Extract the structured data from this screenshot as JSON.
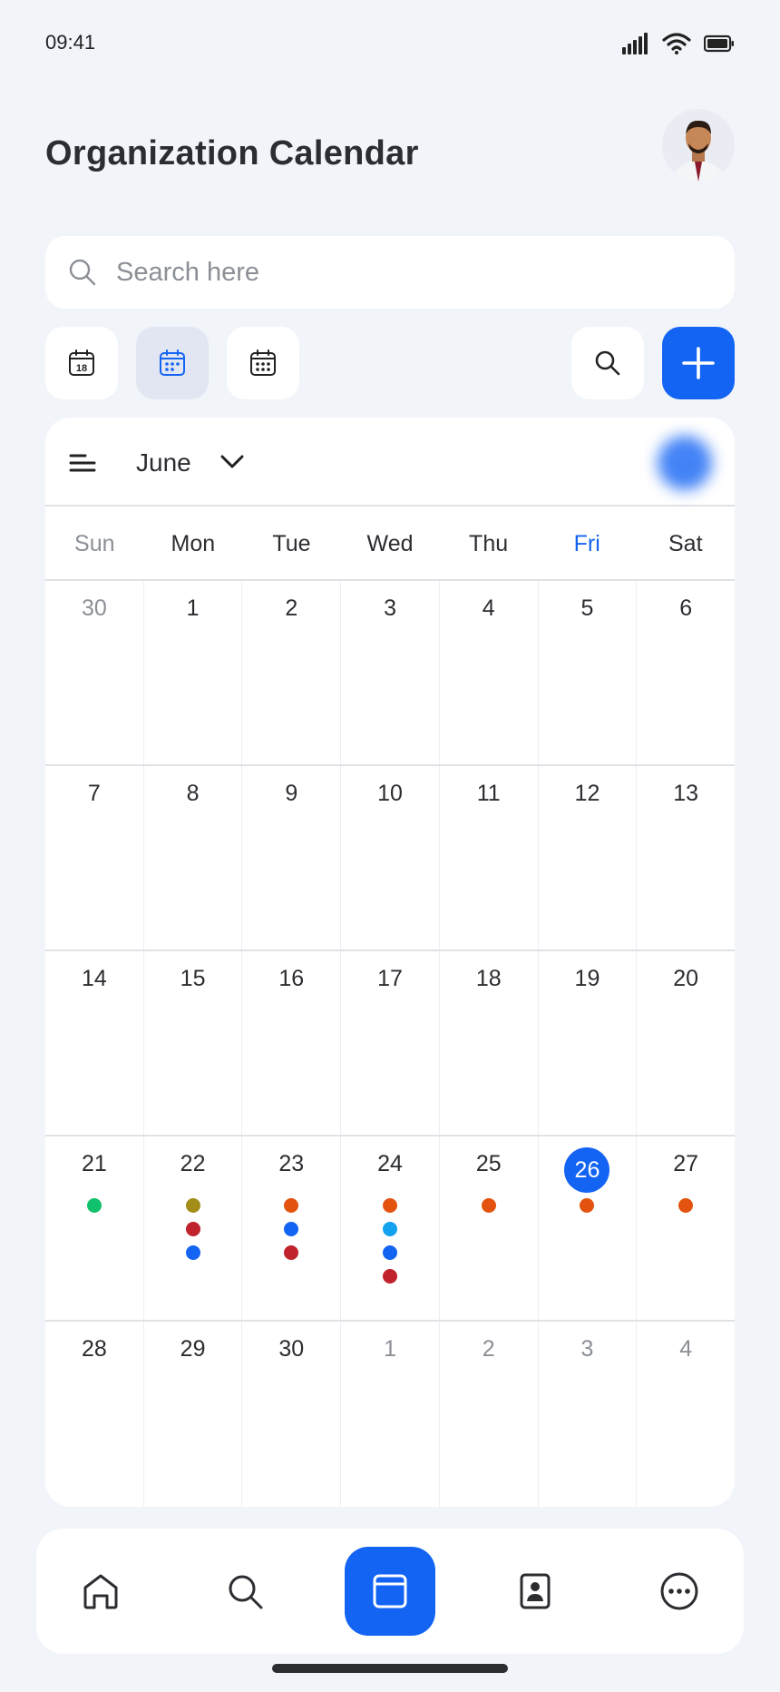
{
  "status": {
    "time": "09:41"
  },
  "header": {
    "title": "Organization Calendar",
    "avatar_icon": "user-avatar"
  },
  "search": {
    "placeholder": "Search here"
  },
  "toolbar": {
    "day_icon_number": "18"
  },
  "calendar": {
    "month": "June",
    "weekdays": [
      "Sun",
      "Mon",
      "Tue",
      "Wed",
      "Thu",
      "Fri",
      "Sat"
    ],
    "today_weekday_index": 5,
    "weeks": [
      [
        {
          "d": "30",
          "muted": true
        },
        {
          "d": "1"
        },
        {
          "d": "2"
        },
        {
          "d": "3"
        },
        {
          "d": "4"
        },
        {
          "d": "5"
        },
        {
          "d": "6"
        }
      ],
      [
        {
          "d": "7"
        },
        {
          "d": "8"
        },
        {
          "d": "9"
        },
        {
          "d": "10"
        },
        {
          "d": "11"
        },
        {
          "d": "12"
        },
        {
          "d": "13"
        }
      ],
      [
        {
          "d": "14"
        },
        {
          "d": "15"
        },
        {
          "d": "16"
        },
        {
          "d": "17"
        },
        {
          "d": "18"
        },
        {
          "d": "19"
        },
        {
          "d": "20"
        }
      ],
      [
        {
          "d": "21",
          "dots": [
            "#11c16b"
          ]
        },
        {
          "d": "22",
          "dots": [
            "#a38c17",
            "#c0232c",
            "#1464f4"
          ]
        },
        {
          "d": "23",
          "dots": [
            "#e3530f",
            "#1464f4",
            "#c0232c"
          ]
        },
        {
          "d": "24",
          "dots": [
            "#e3530f",
            "#12a2f0",
            "#1464f4",
            "#c0232c"
          ]
        },
        {
          "d": "25",
          "dots": [
            "#e3530f"
          ]
        },
        {
          "d": "26",
          "today": true,
          "dots": [
            "#e3530f"
          ]
        },
        {
          "d": "27",
          "dots": [
            "#e3530f"
          ]
        }
      ],
      [
        {
          "d": "28"
        },
        {
          "d": "29"
        },
        {
          "d": "30"
        },
        {
          "d": "1",
          "muted": true
        },
        {
          "d": "2",
          "muted": true
        },
        {
          "d": "3",
          "muted": true
        },
        {
          "d": "4",
          "muted": true
        }
      ]
    ]
  },
  "colors": {
    "accent": "#1464f4",
    "background": "#f1f4f9"
  },
  "nav": {
    "items": [
      "home-icon",
      "search-icon",
      "calendar-icon",
      "contacts-icon",
      "more-icon"
    ],
    "active": 2
  }
}
